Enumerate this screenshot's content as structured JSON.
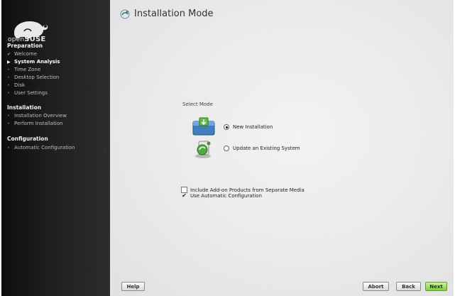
{
  "sidebar": {
    "logo_text_light": "open",
    "logo_text_bold": "SUSE",
    "sections": [
      {
        "title": "Preparation",
        "items": [
          {
            "label": "Welcome",
            "state": "done"
          },
          {
            "label": "System Analysis",
            "state": "active"
          },
          {
            "label": "Time Zone",
            "state": "pending"
          },
          {
            "label": "Desktop Selection",
            "state": "pending"
          },
          {
            "label": "Disk",
            "state": "pending"
          },
          {
            "label": "User Settings",
            "state": "pending"
          }
        ]
      },
      {
        "title": "Installation",
        "items": [
          {
            "label": "Installation Overview",
            "state": "pending"
          },
          {
            "label": "Perform Installation",
            "state": "pending"
          }
        ]
      },
      {
        "title": "Configuration",
        "items": [
          {
            "label": "Automatic Configuration",
            "state": "pending"
          }
        ]
      }
    ]
  },
  "main": {
    "title": "Installation Mode",
    "select_mode_label": "Select Mode",
    "options": [
      {
        "label": "New Installation",
        "selected": true,
        "icon": "new-install-icon"
      },
      {
        "label": "Update an Existing System",
        "selected": false,
        "icon": "update-system-icon"
      }
    ],
    "checkboxes": [
      {
        "label": "Include Add-on Products from Separate Media",
        "checked": false
      },
      {
        "label": "Use Automatic Configuration",
        "checked": true
      }
    ]
  },
  "buttons": {
    "help": "Help",
    "abort": "Abort",
    "back": "Back",
    "next": "Next"
  },
  "colors": {
    "next_button": "#7fcf3c",
    "sidebar_bg": "#1d201f"
  }
}
